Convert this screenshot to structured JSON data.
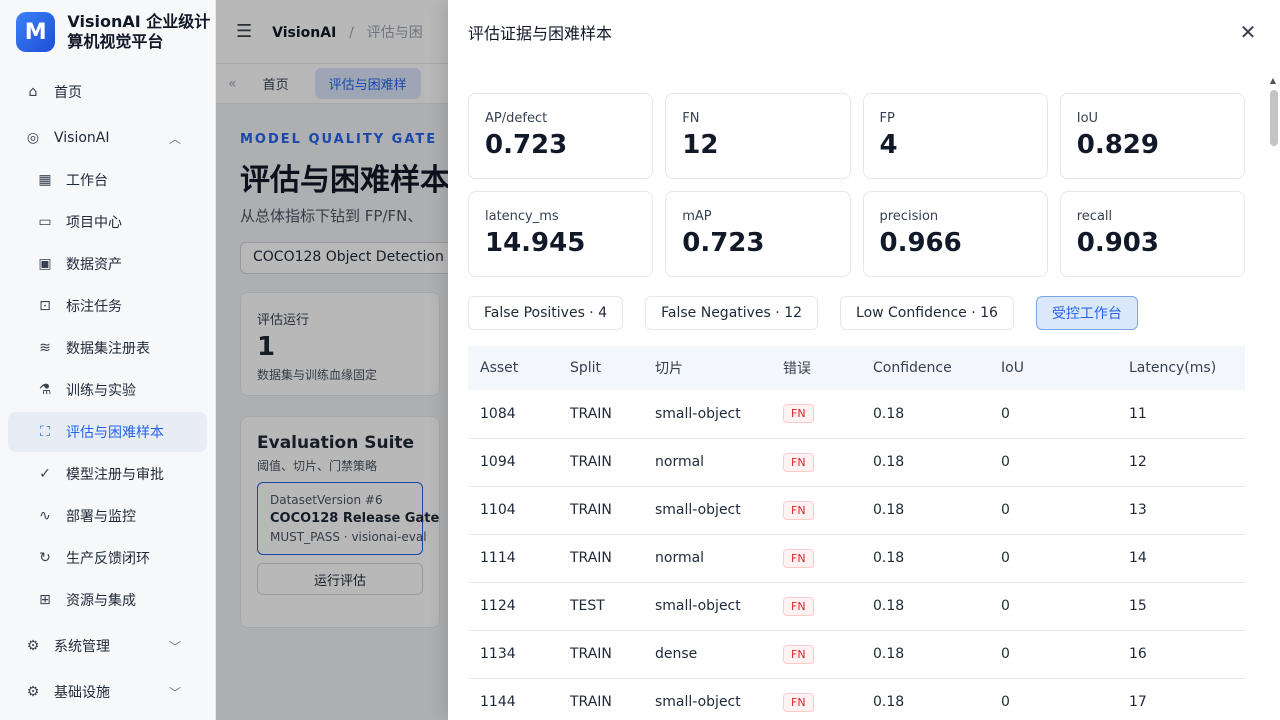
{
  "brand": {
    "logo": "M",
    "name": "VisionAI 企业级计算机视觉平台"
  },
  "sidebar": {
    "items": [
      {
        "label": "首页",
        "icon": "home-icon"
      },
      {
        "label": "VisionAI",
        "icon": "scan-icon"
      },
      {
        "label": "工作台",
        "icon": "grid-icon"
      },
      {
        "label": "项目中心",
        "icon": "folder-icon"
      },
      {
        "label": "数据资产",
        "icon": "image-icon"
      },
      {
        "label": "标注任务",
        "icon": "tag-icon"
      },
      {
        "label": "数据集注册表",
        "icon": "database-icon"
      },
      {
        "label": "训练与实验",
        "icon": "flask-icon"
      },
      {
        "label": "评估与困难样本",
        "icon": "focus-icon"
      },
      {
        "label": "模型注册与审批",
        "icon": "check-circle-icon"
      },
      {
        "label": "部署与监控",
        "icon": "pulse-icon"
      },
      {
        "label": "生产反馈闭环",
        "icon": "refresh-icon"
      },
      {
        "label": "资源与集成",
        "icon": "plugin-icon"
      },
      {
        "label": "系统管理",
        "icon": "gear-icon"
      },
      {
        "label": "基础设施",
        "icon": "cog-icon"
      }
    ]
  },
  "main": {
    "breadcrumb_app": "VisionAI",
    "breadcrumb_sep": "/",
    "breadcrumb_page": "评估与困",
    "tabs": [
      {
        "label": "首页"
      },
      {
        "label": "评估与困难样"
      }
    ],
    "kicker": "MODEL QUALITY GATE",
    "title": "评估与困难样本",
    "subtitle": "从总体指标下钻到 FP/FN、",
    "select_value": "COCO128 Object Detection",
    "run_card": {
      "label": "评估运行",
      "value": "1",
      "note": "数据集与训练血缘固定"
    },
    "suite": {
      "title": "Evaluation Suite",
      "subtitle": "阈值、切片、门禁策略",
      "dataset_version": "DatasetVersion #6",
      "name": "COCO128 Release Gate",
      "policy": "MUST_PASS · visionai-eval",
      "run_button": "运行评估"
    }
  },
  "drawer": {
    "title": "评估证据与困难样本",
    "metrics": [
      {
        "label": "AP/defect",
        "value": "0.723"
      },
      {
        "label": "FN",
        "value": "12"
      },
      {
        "label": "FP",
        "value": "4"
      },
      {
        "label": "IoU",
        "value": "0.829"
      },
      {
        "label": "latency_ms",
        "value": "14.945"
      },
      {
        "label": "mAP",
        "value": "0.723"
      },
      {
        "label": "precision",
        "value": "0.966"
      },
      {
        "label": "recall",
        "value": "0.903"
      }
    ],
    "filters": [
      {
        "label": "False Positives · 4"
      },
      {
        "label": "False Negatives · 12"
      },
      {
        "label": "Low Confidence · 16"
      },
      {
        "label": "受控工作台"
      }
    ],
    "table": {
      "headers": [
        "Asset",
        "Split",
        "切片",
        "错误",
        "Confidence",
        "IoU",
        "Latency(ms)"
      ],
      "rows": [
        [
          "1084",
          "TRAIN",
          "small-object",
          "FN",
          "0.18",
          "0",
          "11"
        ],
        [
          "1094",
          "TRAIN",
          "normal",
          "FN",
          "0.18",
          "0",
          "12"
        ],
        [
          "1104",
          "TRAIN",
          "small-object",
          "FN",
          "0.18",
          "0",
          "13"
        ],
        [
          "1114",
          "TRAIN",
          "normal",
          "FN",
          "0.18",
          "0",
          "14"
        ],
        [
          "1124",
          "TEST",
          "small-object",
          "FN",
          "0.18",
          "0",
          "15"
        ],
        [
          "1134",
          "TRAIN",
          "dense",
          "FN",
          "0.18",
          "0",
          "16"
        ],
        [
          "1144",
          "TRAIN",
          "small-object",
          "FN",
          "0.18",
          "0",
          "17"
        ]
      ]
    }
  },
  "colors": {
    "accent": "#2563eb",
    "error": "#dc2626"
  }
}
